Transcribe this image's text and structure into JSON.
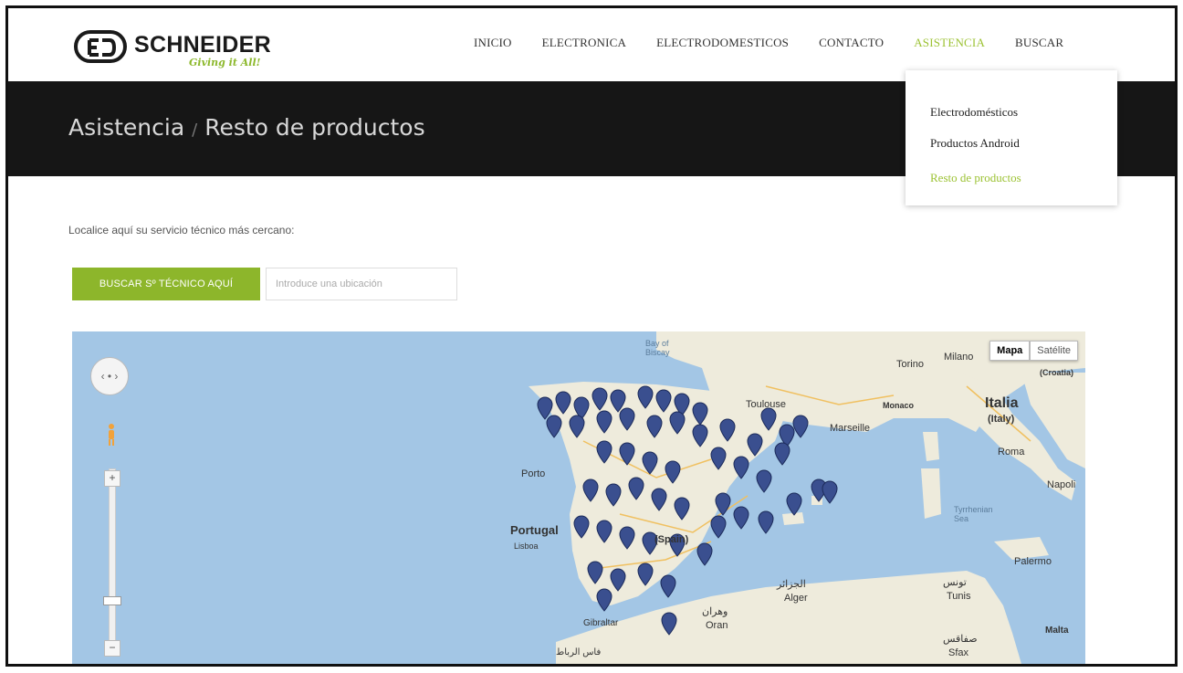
{
  "brand": {
    "name": "SCHNEIDER",
    "tagline": "Giving it All!"
  },
  "nav": {
    "items": [
      {
        "label": "INICIO"
      },
      {
        "label": "ELECTRONICA"
      },
      {
        "label": "ELECTRODOMESTICOS"
      },
      {
        "label": "CONTACTO"
      },
      {
        "label": "ASISTENCIA"
      },
      {
        "label": "BUSCAR"
      }
    ]
  },
  "breadcrumb": {
    "section": "Asistencia",
    "separator": "/",
    "current": "Resto de productos"
  },
  "dropdown": {
    "items": [
      {
        "label": "Electrodomésticos"
      },
      {
        "label": "Productos Android"
      },
      {
        "label": "Resto de productos"
      }
    ]
  },
  "content": {
    "intro": "Localice aquí su servicio técnico más cercano:",
    "search_button": "BUSCAR Sº TÉCNICO AQUÍ",
    "location_placeholder": "Introduce una ubicación"
  },
  "map": {
    "type_buttons": {
      "map": "Mapa",
      "satellite": "Satélite"
    },
    "labels": {
      "bay": "Bay of Biscay",
      "toulouse": "Toulouse",
      "monaco": "Monaco",
      "marseille": "Marseille",
      "torino": "Torino",
      "milano": "Milano",
      "croatia": "(Croatia)",
      "italia": "Italia",
      "italy": "(Italy)",
      "roma": "Roma",
      "napoli": "Napoli",
      "tyrrhenian": "Tyrrhenian Sea",
      "palermo": "Palermo",
      "malta": "Malta",
      "porto": "Porto",
      "portugal": "Portugal",
      "lisboa": "Lisboa",
      "spain": "(Spain)",
      "alger_ar": "الجزائر",
      "alger": "Alger",
      "oran_ar": "وهران",
      "oran": "Oran",
      "tunis_ar": "تونس",
      "tunis": "Tunis",
      "sfax_ar": "صفاقس",
      "sfax": "Sfax",
      "gibraltar": "Gibraltar",
      "rabat_ar": "فاس الرباط"
    },
    "zoom": {
      "in": "+",
      "out": "−"
    },
    "colors": {
      "water": "#a3c6e5",
      "land": "#eeebdc",
      "marker": "#3a4f8f",
      "accent": "#8db62b"
    }
  }
}
